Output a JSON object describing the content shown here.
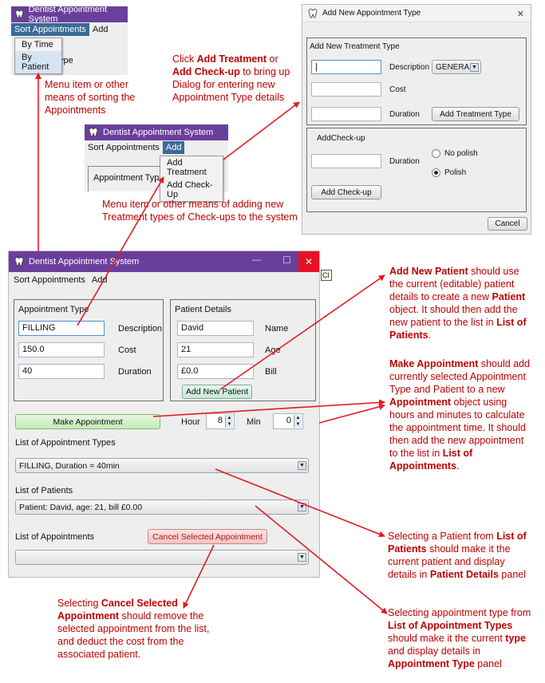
{
  "app_title": "Dentist Appointment System",
  "menu": {
    "sort": "Sort Appointments",
    "add": "Add"
  },
  "sort_menu_items": [
    "By Time",
    "By Patient"
  ],
  "sort_menu_peek": "ype",
  "add_menu_items": [
    "Add Treatment",
    "Add Check-Up"
  ],
  "snippet2_panel_label": "Appointment Type",
  "dialog": {
    "title": "Add New Appointment Type",
    "close": "✕",
    "treatment_section": "Add New Treatment Type",
    "description_label": "Description",
    "description_combo": "GENERAL",
    "cost_label": "Cost",
    "duration_label": "Duration",
    "add_treatment_button": "Add Treatment Type",
    "checkup_section": "AddCheck-up",
    "no_polish": "No polish",
    "polish": "Polish",
    "add_checkup_button": "Add Check-up",
    "cancel_button": "Cancel"
  },
  "main": {
    "minimize": "—",
    "maximize": "☐",
    "close": "✕",
    "tooltip_peek": "Cl",
    "appt_type_panel": "Appointment Type",
    "type_value": "FILLING",
    "description_label": "Description",
    "cost_value": "150.0",
    "cost_label": "Cost",
    "duration_value": "40",
    "duration_label": "Duration",
    "patient_panel": "Patient Details",
    "name_value": "David",
    "name_label": "Name",
    "age_value": "21",
    "age_label": "Age",
    "bill_value": "£0.0",
    "bill_label": "Bill",
    "add_patient_button": "Add New Patient",
    "make_appointment_button": "Make Appointment",
    "hour_label": "Hour",
    "hour_value": "8",
    "min_label": "Min",
    "min_value": "0",
    "list_types_label": "List of Appointment Types",
    "list_types_value": "FILLING, Duration = 40min",
    "list_patients_label": "List of Patients",
    "list_patients_value": "Patient: David, age: 21, bill £0.00",
    "list_appointments_label": "List of Appointments",
    "cancel_selected_button": "Cancel Selected Appointment"
  },
  "annotations": {
    "sort_menu": "Menu item or other means of sorting the Appointments",
    "click_add_treatment": [
      {
        "t": "Click ",
        "b": false
      },
      {
        "t": "Add Treatment",
        "b": true
      },
      {
        "t": " or ",
        "b": false
      },
      {
        "t": "Add Check-up",
        "b": true
      },
      {
        "t": " to bring up Dialog for entering new Appointment Type details",
        "b": false
      }
    ],
    "add_menu": "Menu item or other means of adding new Treatment types of Check-ups to the system",
    "add_new_patient": [
      {
        "t": "Add New Patient",
        "b": true
      },
      {
        "t": " should use the current (editable) patient details to create a new ",
        "b": false
      },
      {
        "t": "Patient",
        "b": true
      },
      {
        "t": " object. It should then add the new patient to the list in ",
        "b": false
      },
      {
        "t": "List of Patients",
        "b": true
      },
      {
        "t": ".",
        "b": false
      }
    ],
    "make_appointment": [
      {
        "t": "Make Appointment",
        "b": true
      },
      {
        "t": " should add currently selected Appointment Type and Patient to a new ",
        "b": false
      },
      {
        "t": "Appointment",
        "b": true
      },
      {
        "t": " object using hours and minutes to calculate the appointment time. It should then add the new appointment to the list in ",
        "b": false
      },
      {
        "t": "List of Appointments",
        "b": true
      },
      {
        "t": ".",
        "b": false
      }
    ],
    "select_patient": [
      {
        "t": "Selecting a Patient from ",
        "b": false
      },
      {
        "t": "List of Patients",
        "b": true
      },
      {
        "t": " should make it the current patient and display details in ",
        "b": false
      },
      {
        "t": "Patient Details",
        "b": true
      },
      {
        "t": " panel",
        "b": false
      }
    ],
    "cancel_selected": [
      {
        "t": "Selecting ",
        "b": false
      },
      {
        "t": "Cancel Selected Appointment",
        "b": true
      },
      {
        "t": " should remove the selected appointment from the list, and deduct the cost from the associated patient.",
        "b": false
      }
    ],
    "select_type": [
      {
        "t": "Selecting appointment type from ",
        "b": false
      },
      {
        "t": "List of Appointment Types",
        "b": true
      },
      {
        "t": " should make it the current ",
        "b": false
      },
      {
        "t": "type",
        "b": true
      },
      {
        "t": " and display details in ",
        "b": false
      },
      {
        "t": "Appointment Type",
        "b": true
      },
      {
        "t": " panel",
        "b": false
      }
    ]
  },
  "colors": {
    "title_purple": "#6a3f9c",
    "annotation_red": "#c00000",
    "make_button_green": "#d4f0c8",
    "cancel_button_pink": "#f6d0d0",
    "menu_active_blue": "#3b6a99",
    "close_red": "#e81123"
  }
}
